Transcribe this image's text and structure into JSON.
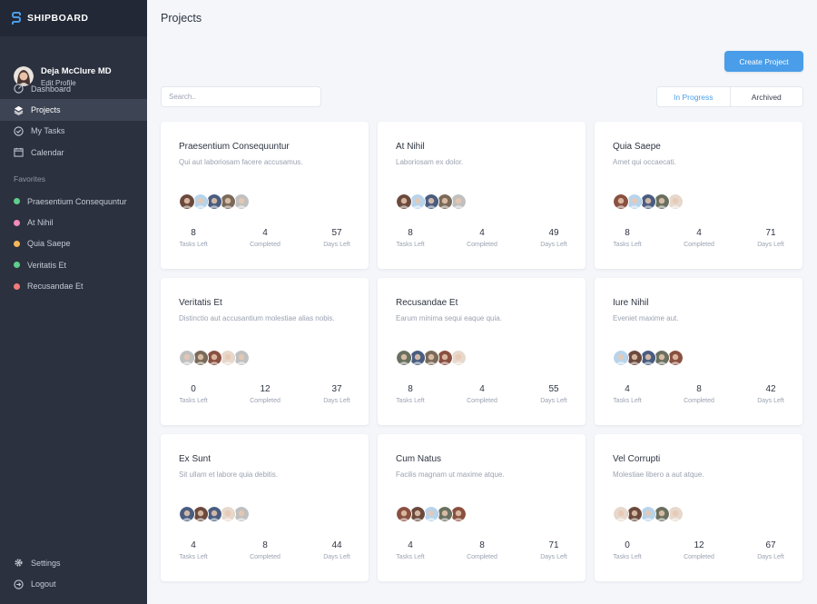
{
  "brand": {
    "name": "SHIPBOARD"
  },
  "profile": {
    "name": "Deja McClure MD",
    "edit_label": "Edit Profile"
  },
  "nav": [
    {
      "label": "Dashboard",
      "icon": "dashboard-icon"
    },
    {
      "label": "Projects",
      "icon": "layers-icon",
      "active": true
    },
    {
      "label": "My Tasks",
      "icon": "check-circle-icon"
    },
    {
      "label": "Calendar",
      "icon": "calendar-icon"
    }
  ],
  "favorites": {
    "heading": "Favorites",
    "items": [
      {
        "label": "Praesentium Consequuntur",
        "color": "#5fce8a"
      },
      {
        "label": "At Nihil",
        "color": "#f08cb8"
      },
      {
        "label": "Quia Saepe",
        "color": "#f5b65a"
      },
      {
        "label": "Veritatis Et",
        "color": "#5fce8a"
      },
      {
        "label": "Recusandae Et",
        "color": "#f27a7a"
      }
    ]
  },
  "bottom_nav": [
    {
      "label": "Settings",
      "icon": "gear-icon"
    },
    {
      "label": "Logout",
      "icon": "logout-icon"
    }
  ],
  "main": {
    "title": "Projects",
    "create_label": "Create Project",
    "search_placeholder": "Search..",
    "tabs": [
      {
        "label": "In Progress",
        "active": true
      },
      {
        "label": "Archived"
      }
    ],
    "stat_labels": {
      "tasks": "Tasks Left",
      "completed": "Completed",
      "days": "Days Left"
    }
  },
  "projects": [
    {
      "title": "Praesentium Consequuntur",
      "description": "Qui aut laboriosam facere accusamus.",
      "tasks_left": "8",
      "completed": "4",
      "days_left": "57",
      "avatars": [
        "#6b4a3d",
        "#b8d4ec",
        "#4a5d80",
        "#7a6a5a",
        "#c0c0c0"
      ]
    },
    {
      "title": "At Nihil",
      "description": "Laboriosam ex dolor.",
      "tasks_left": "8",
      "completed": "4",
      "days_left": "49",
      "avatars": [
        "#6b4a3d",
        "#b8d4ec",
        "#4a5d80",
        "#7a6a5a",
        "#c0c0c0"
      ]
    },
    {
      "title": "Quia Saepe",
      "description": "Amet qui occaecati.",
      "tasks_left": "8",
      "completed": "4",
      "days_left": "71",
      "avatars": [
        "#8a5040",
        "#b8d4ec",
        "#4a5d80",
        "#6a7060",
        "#e6d8cc"
      ]
    },
    {
      "title": "Veritatis Et",
      "description": "Distinctio aut accusantium molestiae alias nobis.",
      "tasks_left": "0",
      "completed": "12",
      "days_left": "37",
      "avatars": [
        "#c0c0c0",
        "#7a6a5a",
        "#8a5040",
        "#e6d8cc",
        "#c0c0c0"
      ]
    },
    {
      "title": "Recusandae Et",
      "description": "Earum minima sequi eaque quia.",
      "tasks_left": "8",
      "completed": "4",
      "days_left": "55",
      "avatars": [
        "#6a7060",
        "#4a5d80",
        "#7a6a5a",
        "#8a5040",
        "#e6d8cc"
      ]
    },
    {
      "title": "Iure Nihil",
      "description": "Eveniet maxime aut.",
      "tasks_left": "4",
      "completed": "8",
      "days_left": "42",
      "avatars": [
        "#b8d4ec",
        "#6b4a3d",
        "#4a5d80",
        "#6a7060",
        "#8a5040"
      ]
    },
    {
      "title": "Ex Sunt",
      "description": "Sit ullam et labore quia debitis.",
      "tasks_left": "4",
      "completed": "8",
      "days_left": "44",
      "avatars": [
        "#4a5d80",
        "#6b4a3d",
        "#4a5d80",
        "#e6d8cc",
        "#c0c0c0"
      ]
    },
    {
      "title": "Cum Natus",
      "description": "Facilis magnam ut maxime atque.",
      "tasks_left": "4",
      "completed": "8",
      "days_left": "71",
      "avatars": [
        "#8a5040",
        "#6b4a3d",
        "#b8d4ec",
        "#6a7060",
        "#8a5040"
      ]
    },
    {
      "title": "Vel Corrupti",
      "description": "Molestiae libero a aut atque.",
      "tasks_left": "0",
      "completed": "12",
      "days_left": "67",
      "avatars": [
        "#e6d8cc",
        "#6b4a3d",
        "#b8d4ec",
        "#6a7060",
        "#e6d8cc"
      ]
    }
  ]
}
